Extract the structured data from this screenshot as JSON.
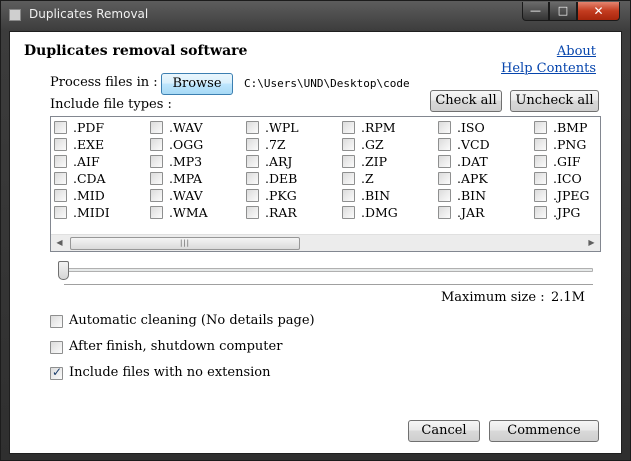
{
  "window": {
    "title": "Duplicates Removal",
    "min_glyph": "—",
    "max_glyph": "□",
    "close_glyph": "✕"
  },
  "header": {
    "heading": "Duplicates removal software",
    "about_link": "About",
    "help_link": "Help Contents"
  },
  "process": {
    "label": "Process files in :",
    "browse_label": "Browse",
    "path": "C:\\Users\\UND\\Desktop\\code"
  },
  "types": {
    "label": "Include file types :",
    "check_all": "Check all",
    "uncheck_all": "Uncheck all",
    "columns": [
      [
        ".PDF",
        ".EXE",
        ".AIF",
        ".CDA",
        ".MID",
        ".MIDI"
      ],
      [
        ".WAV",
        ".OGG",
        ".MP3",
        ".MPA",
        ".WAV",
        ".WMA"
      ],
      [
        ".WPL",
        ".7Z",
        ".ARJ",
        ".DEB",
        ".PKG",
        ".RAR"
      ],
      [
        ".RPM",
        ".GZ",
        ".ZIP",
        ".Z",
        ".BIN",
        ".DMG"
      ],
      [
        ".ISO",
        ".VCD",
        ".DAT",
        ".APK",
        ".BIN",
        ".JAR"
      ],
      [
        ".BMP",
        ".PNG",
        ".GIF",
        ".ICO",
        ".JPEG",
        ".JPG"
      ]
    ]
  },
  "scroll": {
    "left_arrow": "◀",
    "right_arrow": "▶",
    "grip": "|||"
  },
  "size": {
    "label": "Maximum size :",
    "value": "2.1M",
    "slider_fraction": 0.0
  },
  "options": [
    {
      "label": "Automatic cleaning (No details page)",
      "checked": false
    },
    {
      "label": "After finish, shutdown computer",
      "checked": false
    },
    {
      "label": "Include files with no extension",
      "checked": true
    }
  ],
  "footer": {
    "cancel_label": "Cancel",
    "commence_label": "Commence"
  }
}
